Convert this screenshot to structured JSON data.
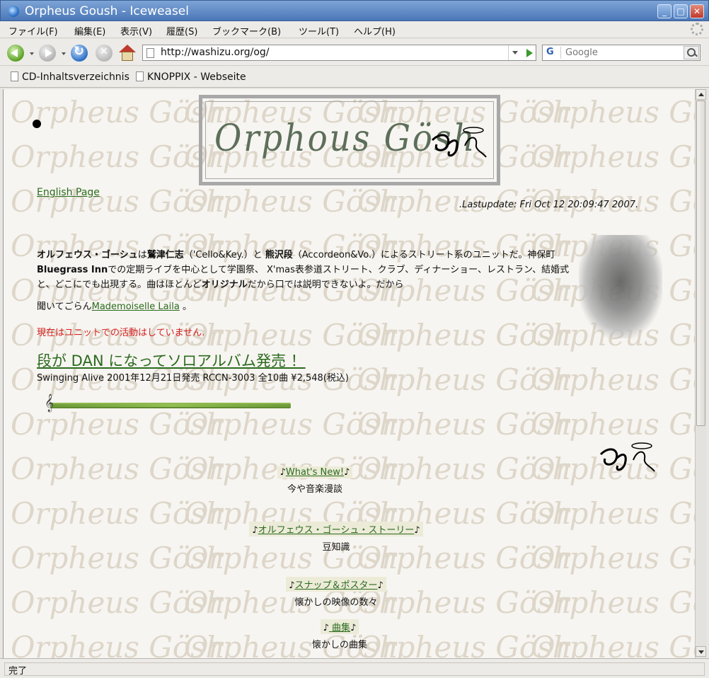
{
  "window": {
    "title": "Orpheus Goush - Iceweasel"
  },
  "menubar": {
    "items": [
      "ファイル(F)",
      "編集(E)",
      "表示(V)",
      "履歴(S)",
      "ブックマーク(B)",
      "ツール(T)",
      "ヘルプ(H)"
    ]
  },
  "toolbar": {
    "url": "http://washizu.org/og/",
    "search_placeholder": "Google",
    "search_engine": "G"
  },
  "bookmarks": {
    "items": [
      "CD-Inhaltsverzeichnis",
      "KNOPPIX - Webseite"
    ]
  },
  "page": {
    "logo_text": "Orphous Gösh",
    "english_link": "English Page",
    "last_update": ".Lastupdate: Fri Oct 12 20:09:47 2007.",
    "intro": {
      "p1_a": "オルフェウス・ゴーシュ",
      "p1_b": "は",
      "p1_c": "鷲津仁志",
      "p1_d": "（'Cello&Key.）と ",
      "p1_e": "熊沢段",
      "p1_f": "（Accordeon&Vo.）によるストリート系のユニットだ。神保町",
      "p1_g": "Bluegrass Inn",
      "p1_h": "での定期ライブを中心として学園祭、 X'mas表参道ストリート、クラブ、ディナーショー、レストラン、結婚式と、どこにでも出現する。曲はほとんど",
      "p1_i": "オリジナル",
      "p1_j": "だから口では説明できないよ。だから",
      "p2_pre": "聞いてごらん",
      "p2_link": "Mademoiselle Laila",
      "p2_post": " 。"
    },
    "notice": "現在はユニットでの活動はしていません.",
    "dan_link": "段が DAN になってソロアルバム発売 ！",
    "album_info": "Swinging Alive 2001年12月21日発売 RCCN-3003  全10曲  ¥2,548(税込)",
    "watermark_text": "Orpheus Gösh",
    "menu_items": [
      {
        "link": "What's New!",
        "sub": "今や音楽漫談"
      },
      {
        "link": "オルフェウス・ゴーシュ・ストーリー",
        "sub": "豆知識"
      },
      {
        "link": "スナップ＆ポスター",
        "sub": "懐かしの映像の数々"
      },
      {
        "link": " 曲集",
        "sub": "懐かしの曲集"
      }
    ],
    "note_symbol": "♪"
  },
  "status": {
    "text": "完了"
  },
  "colors": {
    "link": "#2b6b1e",
    "notice": "#d42020",
    "titlebar": "#4a77b8"
  }
}
